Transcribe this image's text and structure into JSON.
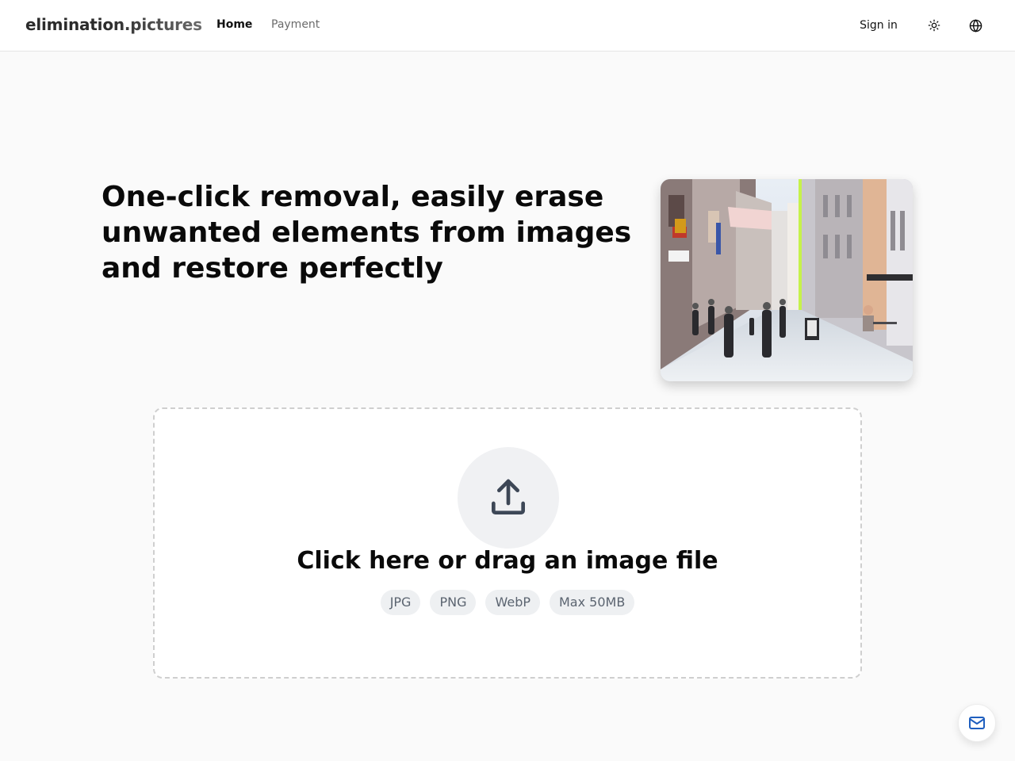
{
  "header": {
    "logo": "elimination.pictures",
    "nav": {
      "home": "Home",
      "payment": "Payment"
    },
    "sign_in": "Sign in",
    "theme_icon": "sun-icon",
    "language_icon": "globe-icon"
  },
  "hero": {
    "title": "One-click removal, easily erase unwanted elements from images and restore perfectly",
    "image_icon": "street-scene-image",
    "divider_color": "#c6f24a"
  },
  "upload": {
    "icon": "upload-icon",
    "title": "Click here or drag an image file",
    "formats": [
      "JPG",
      "PNG",
      "WebP",
      "Max 50MB"
    ]
  },
  "floating": {
    "icon": "mail-icon",
    "accent": "#1f5fbf"
  }
}
